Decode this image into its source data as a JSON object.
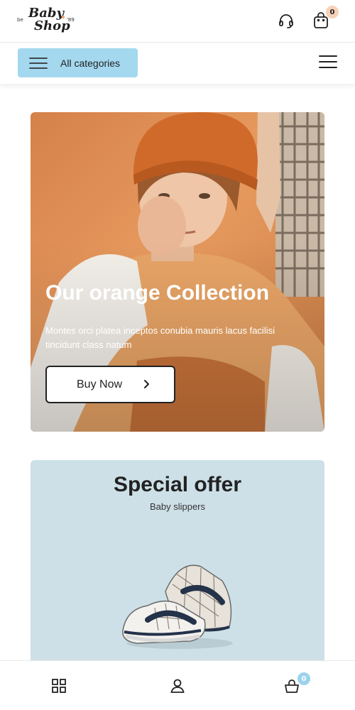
{
  "header": {
    "logo": {
      "prefix": "be",
      "line1": "Baby",
      "line2": "Shop",
      "suffix": "'89"
    },
    "support_icon": "headset-icon",
    "cart_icon": "shopping-bag-icon",
    "cart_count": "0"
  },
  "category_bar": {
    "button_label": "All categories",
    "button_icon": "hamburger-icon",
    "menu_icon": "hamburger-icon"
  },
  "hero": {
    "title": "Our orange Collection",
    "text": "Montes orci platea inceptos conubia mauris lacus facilisi tincidunt class natum",
    "button_label": "Buy Now",
    "button_icon": "chevron-right-icon",
    "background_color": "#d98a50"
  },
  "special_offer": {
    "title": "Special offer",
    "subtitle": "Baby slippers",
    "background_color": "#cde0e8"
  },
  "bottom_nav": {
    "items": [
      {
        "icon": "grid-icon"
      },
      {
        "icon": "user-icon"
      },
      {
        "icon": "basket-icon",
        "badge": "0"
      }
    ]
  },
  "colors": {
    "accent_blue": "#a3d8ef",
    "cart_badge": "#f6d2b7",
    "nav_badge": "#9bd3ec"
  }
}
